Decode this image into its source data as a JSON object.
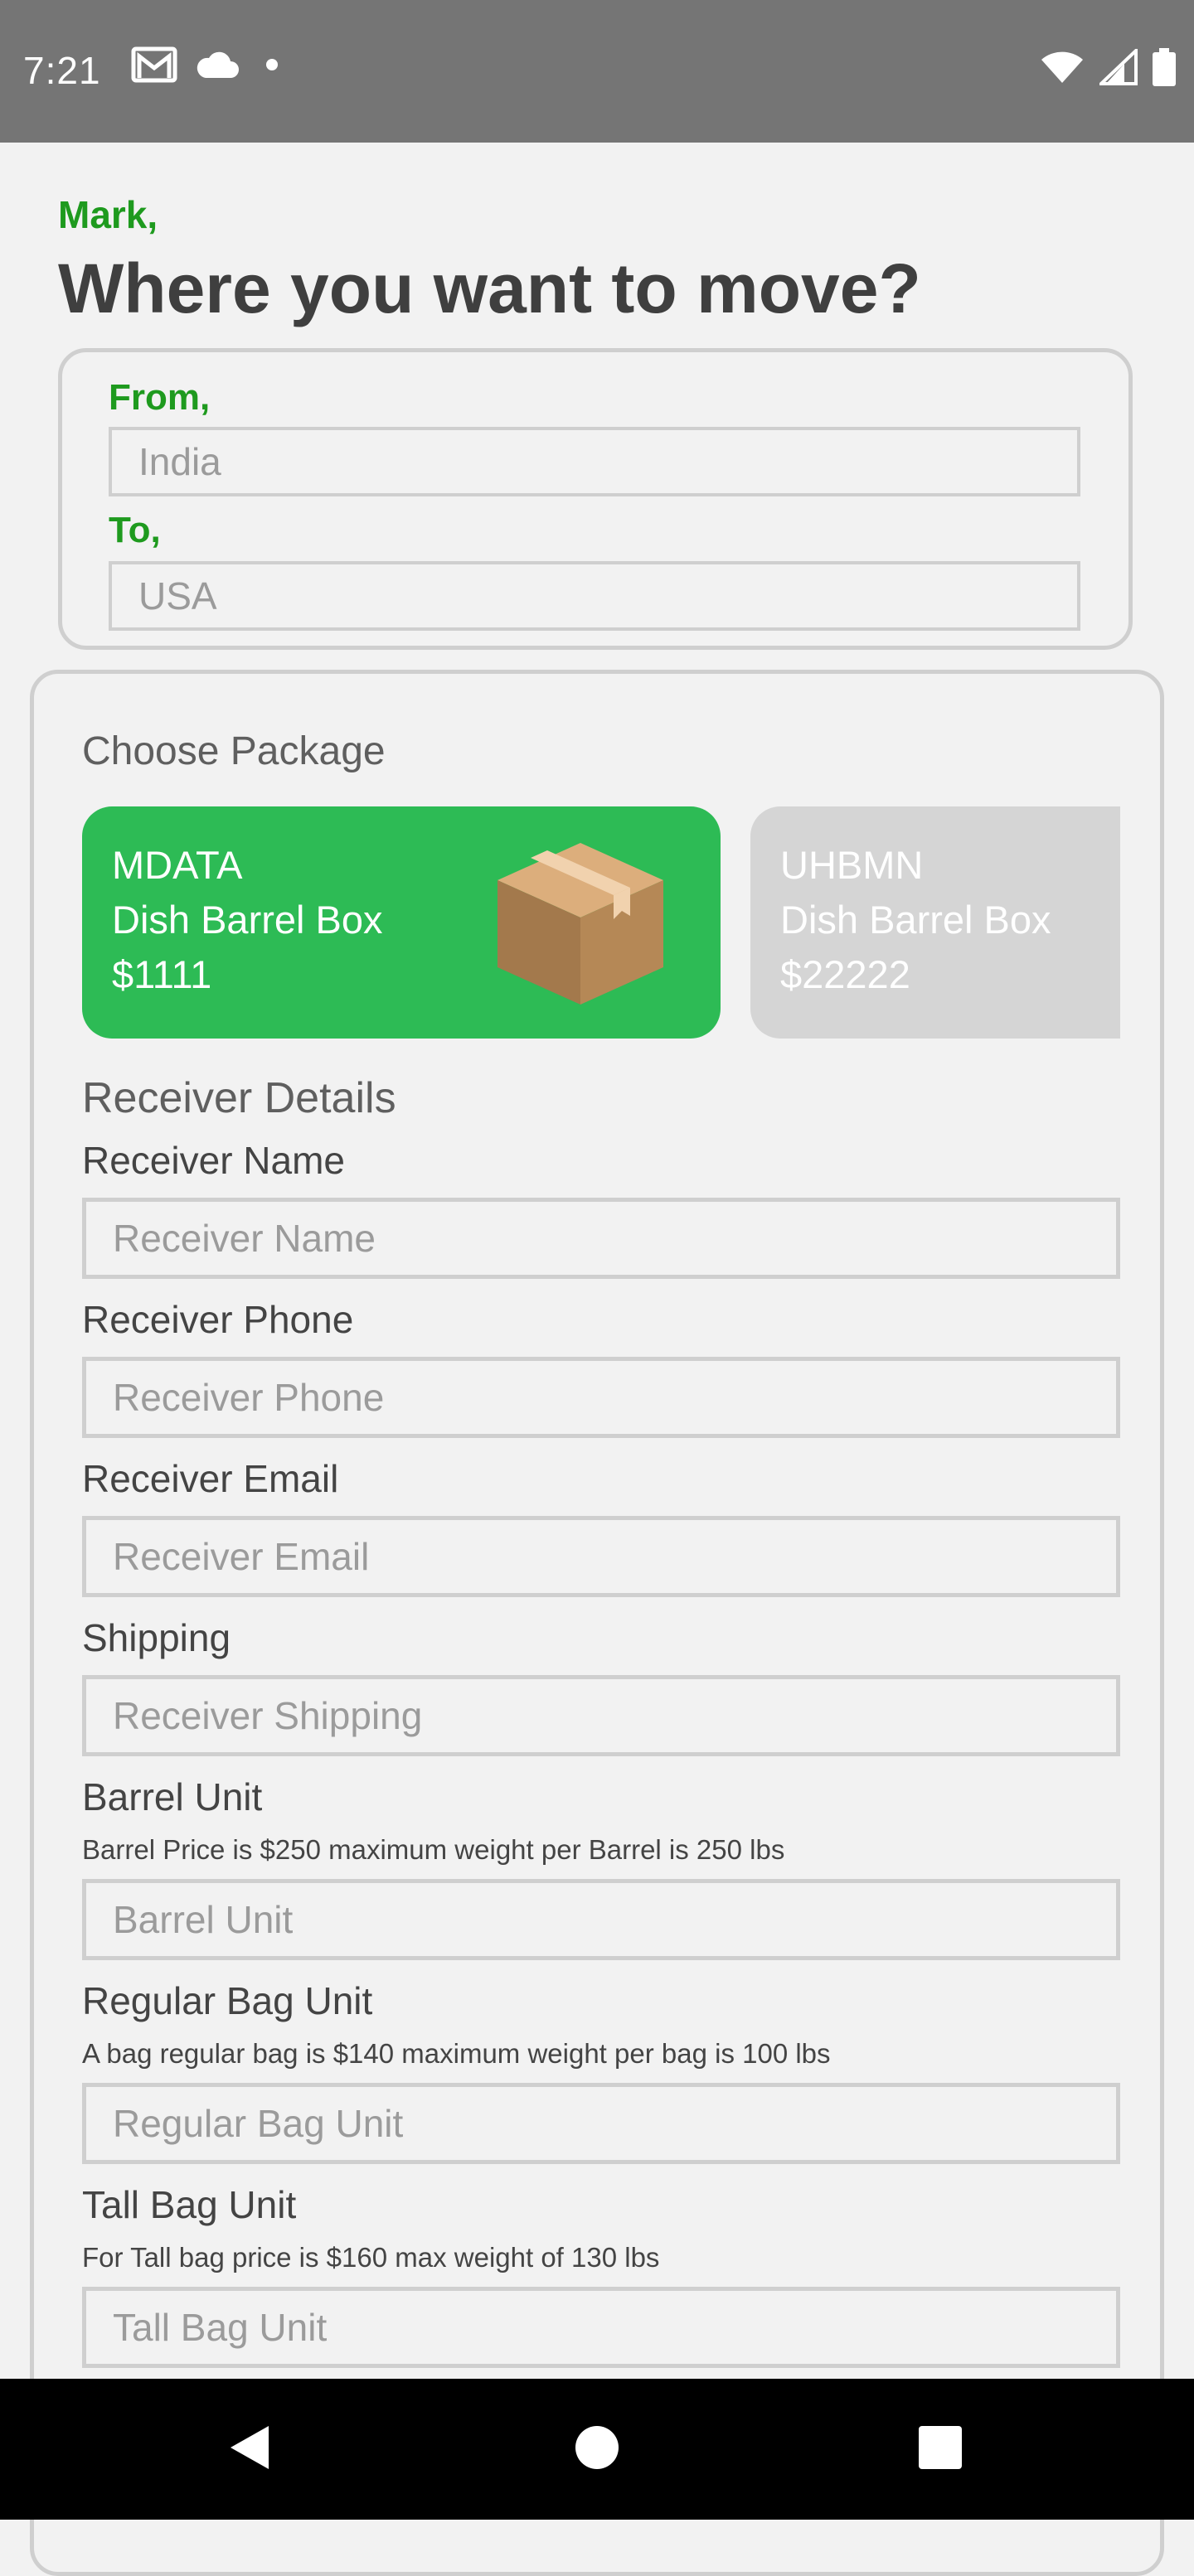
{
  "status_bar": {
    "time": "7:21",
    "left_icons": [
      "gmail-icon",
      "cloud-icon",
      "dot-icon"
    ],
    "right_icons": [
      "wifi-icon",
      "signal-icon",
      "battery-icon"
    ]
  },
  "header": {
    "greeting": "Mark,",
    "title": "Where you want to move?"
  },
  "route": {
    "from_label": "From,",
    "from_placeholder": "India",
    "to_label": "To,",
    "to_placeholder": "USA"
  },
  "packages": {
    "section_title": "Choose Package",
    "items": [
      {
        "code": "MDATA",
        "name": "Dish Barrel Box",
        "price": "$1111",
        "selected": true,
        "color": "#2dbb55"
      },
      {
        "code": "UHBMN",
        "name": "Dish Barrel Box",
        "price": "$22222",
        "selected": false,
        "color": "#d5d5d5"
      }
    ]
  },
  "receiver": {
    "section_title": "Receiver Details",
    "fields": [
      {
        "label": "Receiver Name",
        "placeholder": "Receiver Name"
      },
      {
        "label": "Receiver Phone",
        "placeholder": "Receiver Phone"
      },
      {
        "label": "Receiver Email",
        "placeholder": "Receiver Email"
      },
      {
        "label": "Shipping",
        "placeholder": "Receiver Shipping"
      },
      {
        "label": "Barrel Unit",
        "help": "Barrel Price is $250 maximum weight per Barrel is 250 lbs",
        "placeholder": "Barrel Unit"
      },
      {
        "label": "Regular Bag Unit",
        "help": "A bag regular bag is $140 maximum weight per bag is 100 lbs",
        "placeholder": "Regular Bag Unit"
      },
      {
        "label": "Tall Bag Unit",
        "help": "For Tall bag price is $160 max weight of 130 lbs",
        "placeholder": "Tall Bag Unit"
      }
    ]
  },
  "nav_bar": {
    "buttons": [
      "back-icon",
      "home-icon",
      "recents-icon"
    ]
  },
  "colors": {
    "accent_green": "#1e9a1e",
    "package_green": "#2dbb55",
    "package_grey": "#d5d5d5",
    "status_bar": "#757575",
    "background": "#f2f2f2"
  }
}
